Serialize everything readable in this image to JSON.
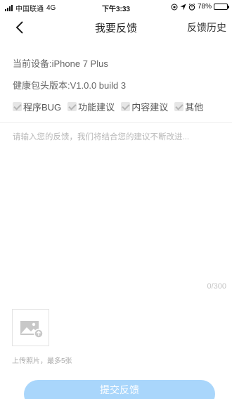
{
  "status_bar": {
    "carrier": "中国联通",
    "network": "4G",
    "time": "下午3:33",
    "battery": "78%",
    "battery_level": 0.78
  },
  "header": {
    "title": "我要反馈",
    "history_label": "反馈历史"
  },
  "info": {
    "device": "当前设备:iPhone 7 Plus",
    "version": "健康包头版本:V1.0.0 build 3"
  },
  "categories": [
    {
      "label": "程序BUG"
    },
    {
      "label": "功能建议"
    },
    {
      "label": "内容建议"
    },
    {
      "label": "其他"
    }
  ],
  "feedback": {
    "placeholder": "请输入您的反馈，我们将结合您的建议不断改进...",
    "value": "",
    "counter": "0/300"
  },
  "upload": {
    "hint": "上传照片，最多5张"
  },
  "submit_label": "提交反馈",
  "colors": {
    "accent": "#a9d6fb",
    "placeholder": "#b8b8b8",
    "checkbox": "#e6e6e6"
  }
}
